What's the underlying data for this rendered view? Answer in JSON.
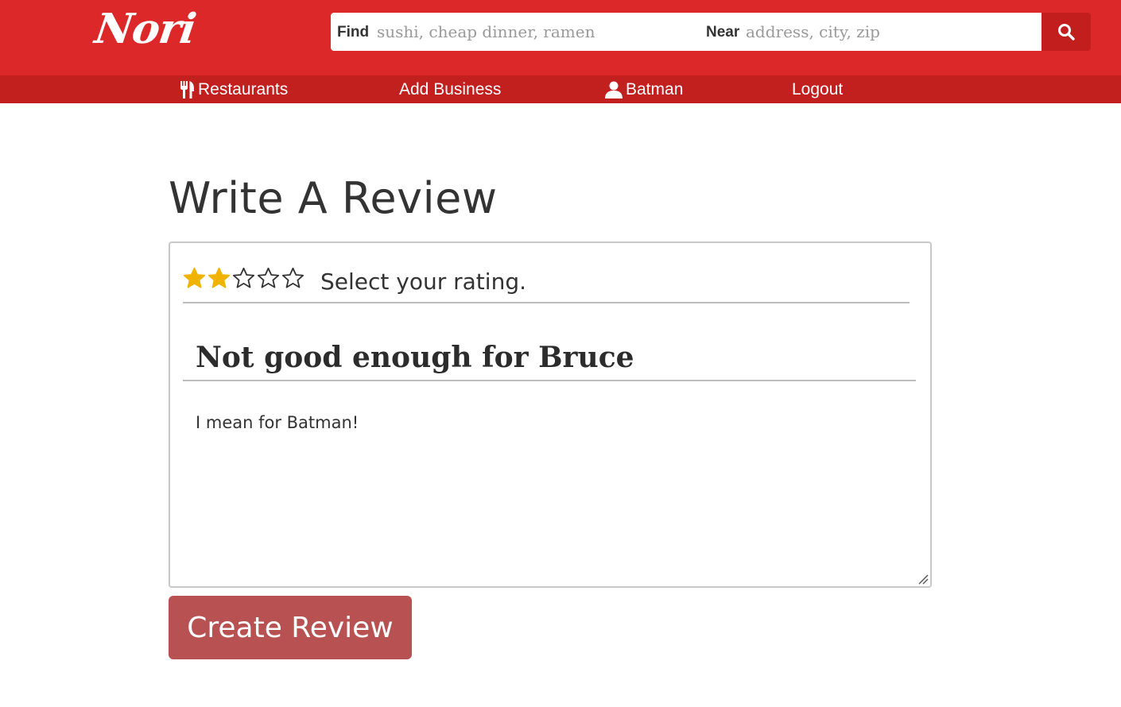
{
  "brand": {
    "logo_text": "Nori",
    "primary_color": "#dc2828",
    "nav_color": "#c21f1f"
  },
  "search": {
    "find_label": "Find",
    "find_placeholder": "sushi, cheap dinner, ramen",
    "near_label": "Near",
    "near_placeholder": "address, city, zip",
    "button_icon": "search-icon"
  },
  "nav": {
    "restaurants": {
      "label": "Restaurants",
      "icon": "fork-knife-icon"
    },
    "add_business": {
      "label": "Add Business"
    },
    "user": {
      "label": "Batman",
      "icon": "user-icon"
    },
    "logout": {
      "label": "Logout"
    }
  },
  "page": {
    "title": "Write A Review"
  },
  "review": {
    "rating": 2,
    "max_rating": 5,
    "star_filled_color": "#f0b400",
    "rating_prompt": "Select your rating.",
    "title_value": "Not good enough for Bruce",
    "body_value": "I mean for Batman!",
    "submit_label": "Create Review",
    "submit_color": "#b85252"
  }
}
